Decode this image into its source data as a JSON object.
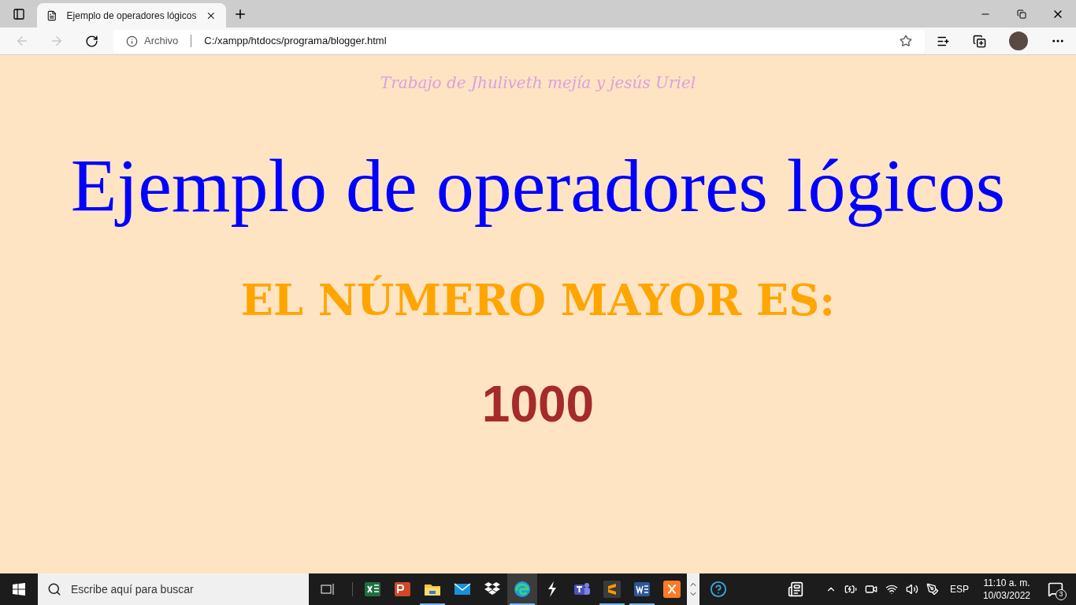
{
  "browser": {
    "tab": {
      "title": "Ejemplo de operadores lógicos",
      "selected": true
    },
    "address": {
      "label": "Archivo",
      "url": "C:/xampp/htdocs/programa/blogger.html"
    }
  },
  "page": {
    "credit": "Trabajo de Jhuliveth mejía y jesús Uriel",
    "title": "Ejemplo de operadores lógicos",
    "heading": "EL NÚMERO MAYOR ES:",
    "result": "1000"
  },
  "taskbar": {
    "search": {
      "placeholder": "Escribe aquí para buscar"
    },
    "apps": [
      {
        "kind": "excel",
        "running": false,
        "selected": false
      },
      {
        "kind": "powerpoint",
        "running": false,
        "selected": false
      },
      {
        "kind": "explorer",
        "running": true,
        "selected": false
      },
      {
        "kind": "mail",
        "running": false,
        "selected": false
      },
      {
        "kind": "dropbox",
        "running": false,
        "selected": false
      },
      {
        "kind": "edge",
        "running": true,
        "selected": true
      },
      {
        "kind": "bolt",
        "running": false,
        "selected": false
      },
      {
        "kind": "teams",
        "running": false,
        "selected": false
      },
      {
        "kind": "sublime",
        "running": true,
        "selected": false
      },
      {
        "kind": "word",
        "running": true,
        "selected": false
      },
      {
        "kind": "xampp",
        "running": false,
        "selected": false
      }
    ],
    "language": "ESP",
    "time": "11:10 a. m.",
    "date": "10/03/2022",
    "notifications": "3"
  }
}
